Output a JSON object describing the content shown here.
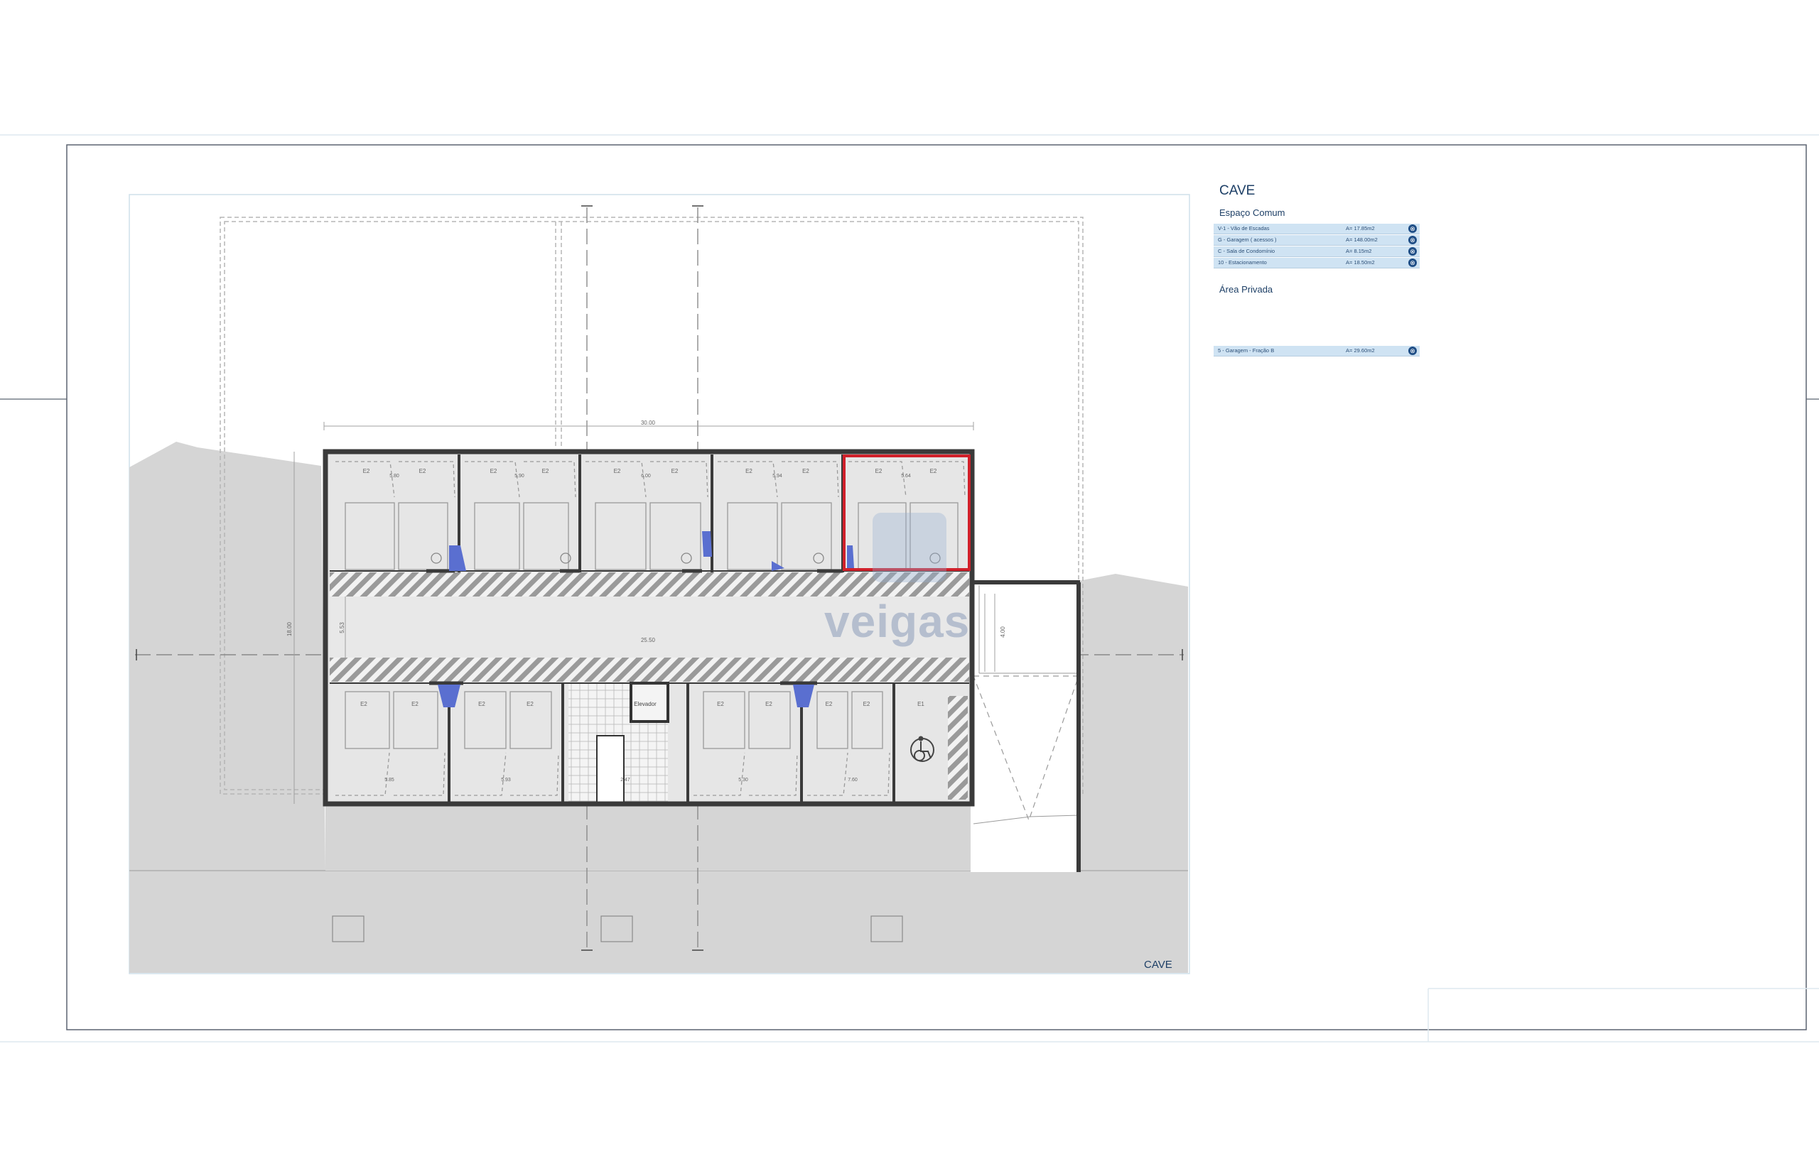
{
  "legend": {
    "title": "CAVE",
    "common_title": "Espaço Comum",
    "common_rows": [
      {
        "label": "V-1 - Vão de Escadas",
        "area": "A=  17.85m2"
      },
      {
        "label": "G  -  Garagem ( acessos )",
        "area": "A= 148.00m2"
      },
      {
        "label": "C  -  Sala de Condomínio",
        "area": "A=  8.15m2"
      },
      {
        "label": "10 - Estacionamento",
        "area": "A= 18.50m2"
      }
    ],
    "private_title": "Área Privada",
    "private_rows": [
      {
        "label": "5 - Garagem - Fração B",
        "area": "A= 29.60m2"
      }
    ]
  },
  "drawing": {
    "cave_label": "CAVE",
    "elevator_label": "Elevador",
    "watermark": "veigas"
  },
  "labels": {
    "top_dims": [
      "5.80",
      "5.90",
      "6.00",
      "5.94",
      "5.64"
    ],
    "bottom_dims": [
      "5.85",
      "5.93",
      "2.47",
      "5.30",
      "7.60"
    ],
    "overall_width": "30.00",
    "aisle_length": "25.50",
    "overall_height": "18.00",
    "aisle_width": "5.53",
    "ramp_width": "4.00",
    "space_tag": "E2",
    "acc_tag": "E1"
  },
  "colors": {
    "wall": "#3a3a3a",
    "floor": "#e6e6e6",
    "terrain": "#d5d5d5",
    "highlight": "#d0202a",
    "blue_marker": "#5a6fd0",
    "legend_row": "#cfe3f3",
    "text_blue": "#1d3f66"
  }
}
